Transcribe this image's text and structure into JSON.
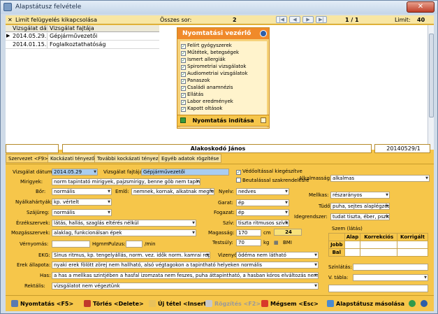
{
  "title": "Alapstátusz felvétele",
  "topbar": {
    "limit_toggle": "Limit felügyelés kikapcsolása",
    "total_label": "Összes sor:",
    "total": "2",
    "pager": "1 / 1",
    "limit_label": "Limit:",
    "limit": "40"
  },
  "grid": {
    "headers": [
      "Vizsgálat dátuma",
      "Vizsgálat fajtája"
    ],
    "rows": [
      [
        "2014.05.29.",
        "Gépjárművezetői"
      ],
      [
        "2014.01.15.",
        "Foglalkoztathatóság"
      ]
    ]
  },
  "printer": {
    "title": "Nyomtatási vezérlő",
    "items": [
      "Felírt gyógyszerek",
      "Műtétek, betegségek",
      "Ismert allergiák",
      "Spirometriai vizsgálatok",
      "Audiometriai vizsgálatok",
      "Panaszok",
      "Családi anamnézis",
      "Ellátás",
      "Labor eredmények",
      "Kapott oltások"
    ],
    "start": "Nyomtatás indítása"
  },
  "patient": {
    "name": "Alakoskodó János",
    "code": "20140529/1"
  },
  "tabs": [
    "Szervezet <F9>",
    "Kockázati tényezők",
    "További kockázati tényezők",
    "Egyéb adatok rögzítése"
  ],
  "form": {
    "date_label": "Vizsgálat dátuma:",
    "date": "2014.05.29",
    "type_label": "Vizsgálat fajtája:",
    "type": "Gépjárművezetői",
    "cb1": "Védőoltással kiegészítve",
    "cb2": "Beutalással szakrendelésre",
    "mirigy_label": "Mirigyek:",
    "mirigy": "norm tapintató mirigyek, pajzsmirigy, benne göb nem tapintható",
    "bor_label": "Bőr:",
    "bor": "normális",
    "emlo_label": "Emlő:",
    "emlo": "nemnek, kornak, alkatnak megfelelő",
    "nyelv_label": "Nyelv:",
    "nyelv": "nedves",
    "nyak_label": "Nyálkahártyák:",
    "nyak": "kp. vértelt",
    "garat_label": "Garat:",
    "garat": "ép",
    "szaj_label": "Szájüreg:",
    "szaj": "normális",
    "fog_label": "Fogazat:",
    "fog": "ép",
    "erz_label": "Érzékszervek:",
    "erz": "látás, hallás, szaglás eltérés nélkül",
    "sziv_label": "Szív:",
    "sziv": "tiszta ritmusos szívhangok",
    "mozg_label": "Mozgásszervek:",
    "mozg": "alaklag, funkcionálsan épek",
    "mag_label": "Magasság:",
    "mag": "170",
    "mag_unit": "cm",
    "bmi_box": "24",
    "suly_label": "Testsúly:",
    "suly": "70",
    "suly_unit": "kg",
    "bmi": "BMI",
    "vern_label": "Vérnyomás:",
    "vern_unit1": "Hgmm",
    "pulz_label": "Pulzus:",
    "pulz_unit": "/min",
    "ekg_label": "EKG:",
    "ekg": "Sinus ritmus, kp. tengelyállás, norm. vez. idők norm. kamrai repol",
    "vizeny_label": "Vizenyő:",
    "vizeny": "ödéma nem látható",
    "erek_label": "Erek állapota:",
    "erek": "nyaki erek fölött zörej nem hallható, alsó végtagokon a tapintható helyeken normális",
    "has_label": "Has:",
    "has": "a has a mellkas szintjében a hasfal izomzata nem feszes, puha áttapintható, a hasban kóros elváltozás nem észlelhető",
    "rekt_label": "Rektális:",
    "rekt": "vizsgálatot nem végeztünk",
    "alk_label": "Alkalmasság:",
    "alk": "alkalmas",
    "mell_label": "Mellkas:",
    "mell": "részarányos",
    "tudo_label": "Tüdő:",
    "tudo": "puha, sejtes alaplégzés",
    "ideg_label": "Idegrendszer:",
    "ideg": "tudat tiszta, éber, pszich",
    "szem_title": "Szem (látás)",
    "szem_cols": [
      "Alap",
      "Korrekciós",
      "Korrigált"
    ],
    "szem_rows": [
      "Jobb",
      "Bal"
    ],
    "szin_label": "Színlátás:",
    "vtabla_label": "V. tábla:"
  },
  "bottom": {
    "print": "Nyomtatás <F5>",
    "delete": "Törlés <Delete>",
    "new": "Új tétel <Insert>",
    "save": "Rögzítés <F2>",
    "cancel": "Mégsem <Esc>",
    "copy": "Alapstátusz másolása"
  }
}
